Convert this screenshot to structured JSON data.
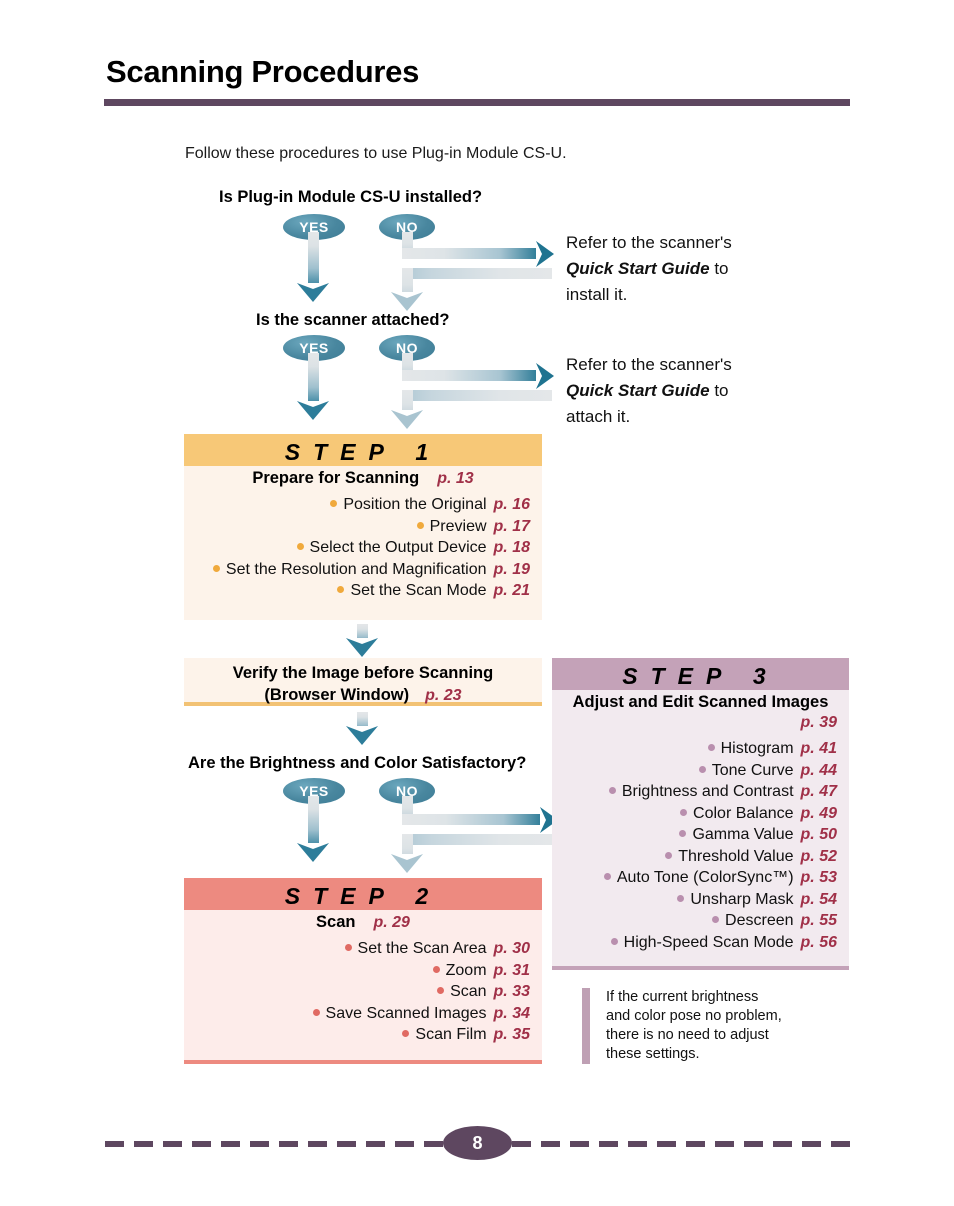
{
  "document": {
    "title": "Scanning Procedures",
    "intro": "Follow these procedures to use Plug-in Module CS-U.",
    "page_number": "8"
  },
  "colors": {
    "title_rule": "#5E4760",
    "badge_teal": "#49879F",
    "arrow_teal": "#1F7390",
    "page_ref": "#A03048",
    "step1_header": "#F7C877",
    "step1_body": "#FDF3EA",
    "step2_header": "#ED8A80",
    "step2_body": "#FDECEA",
    "step3_header": "#C4A2B8",
    "step3_body": "#F2EAEF"
  },
  "decisions": [
    {
      "question": "Is Plug-in Module CS-U installed?",
      "yes_label": "YES",
      "no_label": "NO"
    },
    {
      "question": "Is the scanner attached?",
      "yes_label": "YES",
      "no_label": "NO"
    },
    {
      "question": "Are the Brightness and Color Satisfactory?",
      "yes_label": "YES",
      "no_label": "NO"
    }
  ],
  "refer_notes": [
    {
      "lead": "Refer to the scanner's",
      "emphasis": "Quick Start Guide",
      "tail": "to",
      "last": "install it."
    },
    {
      "lead": "Refer to the scanner's",
      "emphasis": "Quick Start Guide",
      "tail": "to",
      "last": "attach it."
    }
  ],
  "steps": [
    {
      "header": "STEP 1",
      "title": "Prepare for Scanning",
      "title_page": "p. 13",
      "items": [
        {
          "label": "Position the Original",
          "page": "p. 16"
        },
        {
          "label": "Preview",
          "page": "p. 17"
        },
        {
          "label": "Select the Output Device",
          "page": "p. 18"
        },
        {
          "label": "Set the Resolution and Magnification",
          "page": "p. 19"
        },
        {
          "label": "Set the Scan Mode",
          "page": "p. 21"
        }
      ]
    },
    {
      "header": "STEP 2",
      "title": "Scan",
      "title_page": "p. 29",
      "items": [
        {
          "label": "Set the Scan Area",
          "page": "p. 30"
        },
        {
          "label": "Zoom",
          "page": "p. 31"
        },
        {
          "label": "Scan",
          "page": "p. 33"
        },
        {
          "label": "Save Scanned Images",
          "page": "p. 34"
        },
        {
          "label": "Scan Film",
          "page": "p. 35"
        }
      ]
    },
    {
      "header": "STEP 3",
      "title": "Adjust and Edit Scanned Images",
      "title_page": "p. 39",
      "items": [
        {
          "label": "Histogram",
          "page": "p. 41"
        },
        {
          "label": "Tone Curve",
          "page": "p. 44"
        },
        {
          "label": "Brightness and Contrast",
          "page": "p. 47"
        },
        {
          "label": "Color Balance",
          "page": "p. 49"
        },
        {
          "label": "Gamma Value",
          "page": "p. 50"
        },
        {
          "label": "Threshold Value",
          "page": "p. 52"
        },
        {
          "label": "Auto Tone (ColorSync™)",
          "page": "p. 53"
        },
        {
          "label": "Unsharp Mask",
          "page": "p. 54"
        },
        {
          "label": "Descreen",
          "page": "p. 55"
        },
        {
          "label": "High-Speed Scan Mode",
          "page": "p. 56"
        }
      ]
    }
  ],
  "verify_box": {
    "line1": "Verify the Image before Scanning",
    "line2": "(Browser Window)",
    "page": "p. 23"
  },
  "bottom_note": {
    "line1": "If the current brightness",
    "line2": "and color pose no problem,",
    "line3": "there is no need to adjust",
    "line4": "these settings."
  }
}
